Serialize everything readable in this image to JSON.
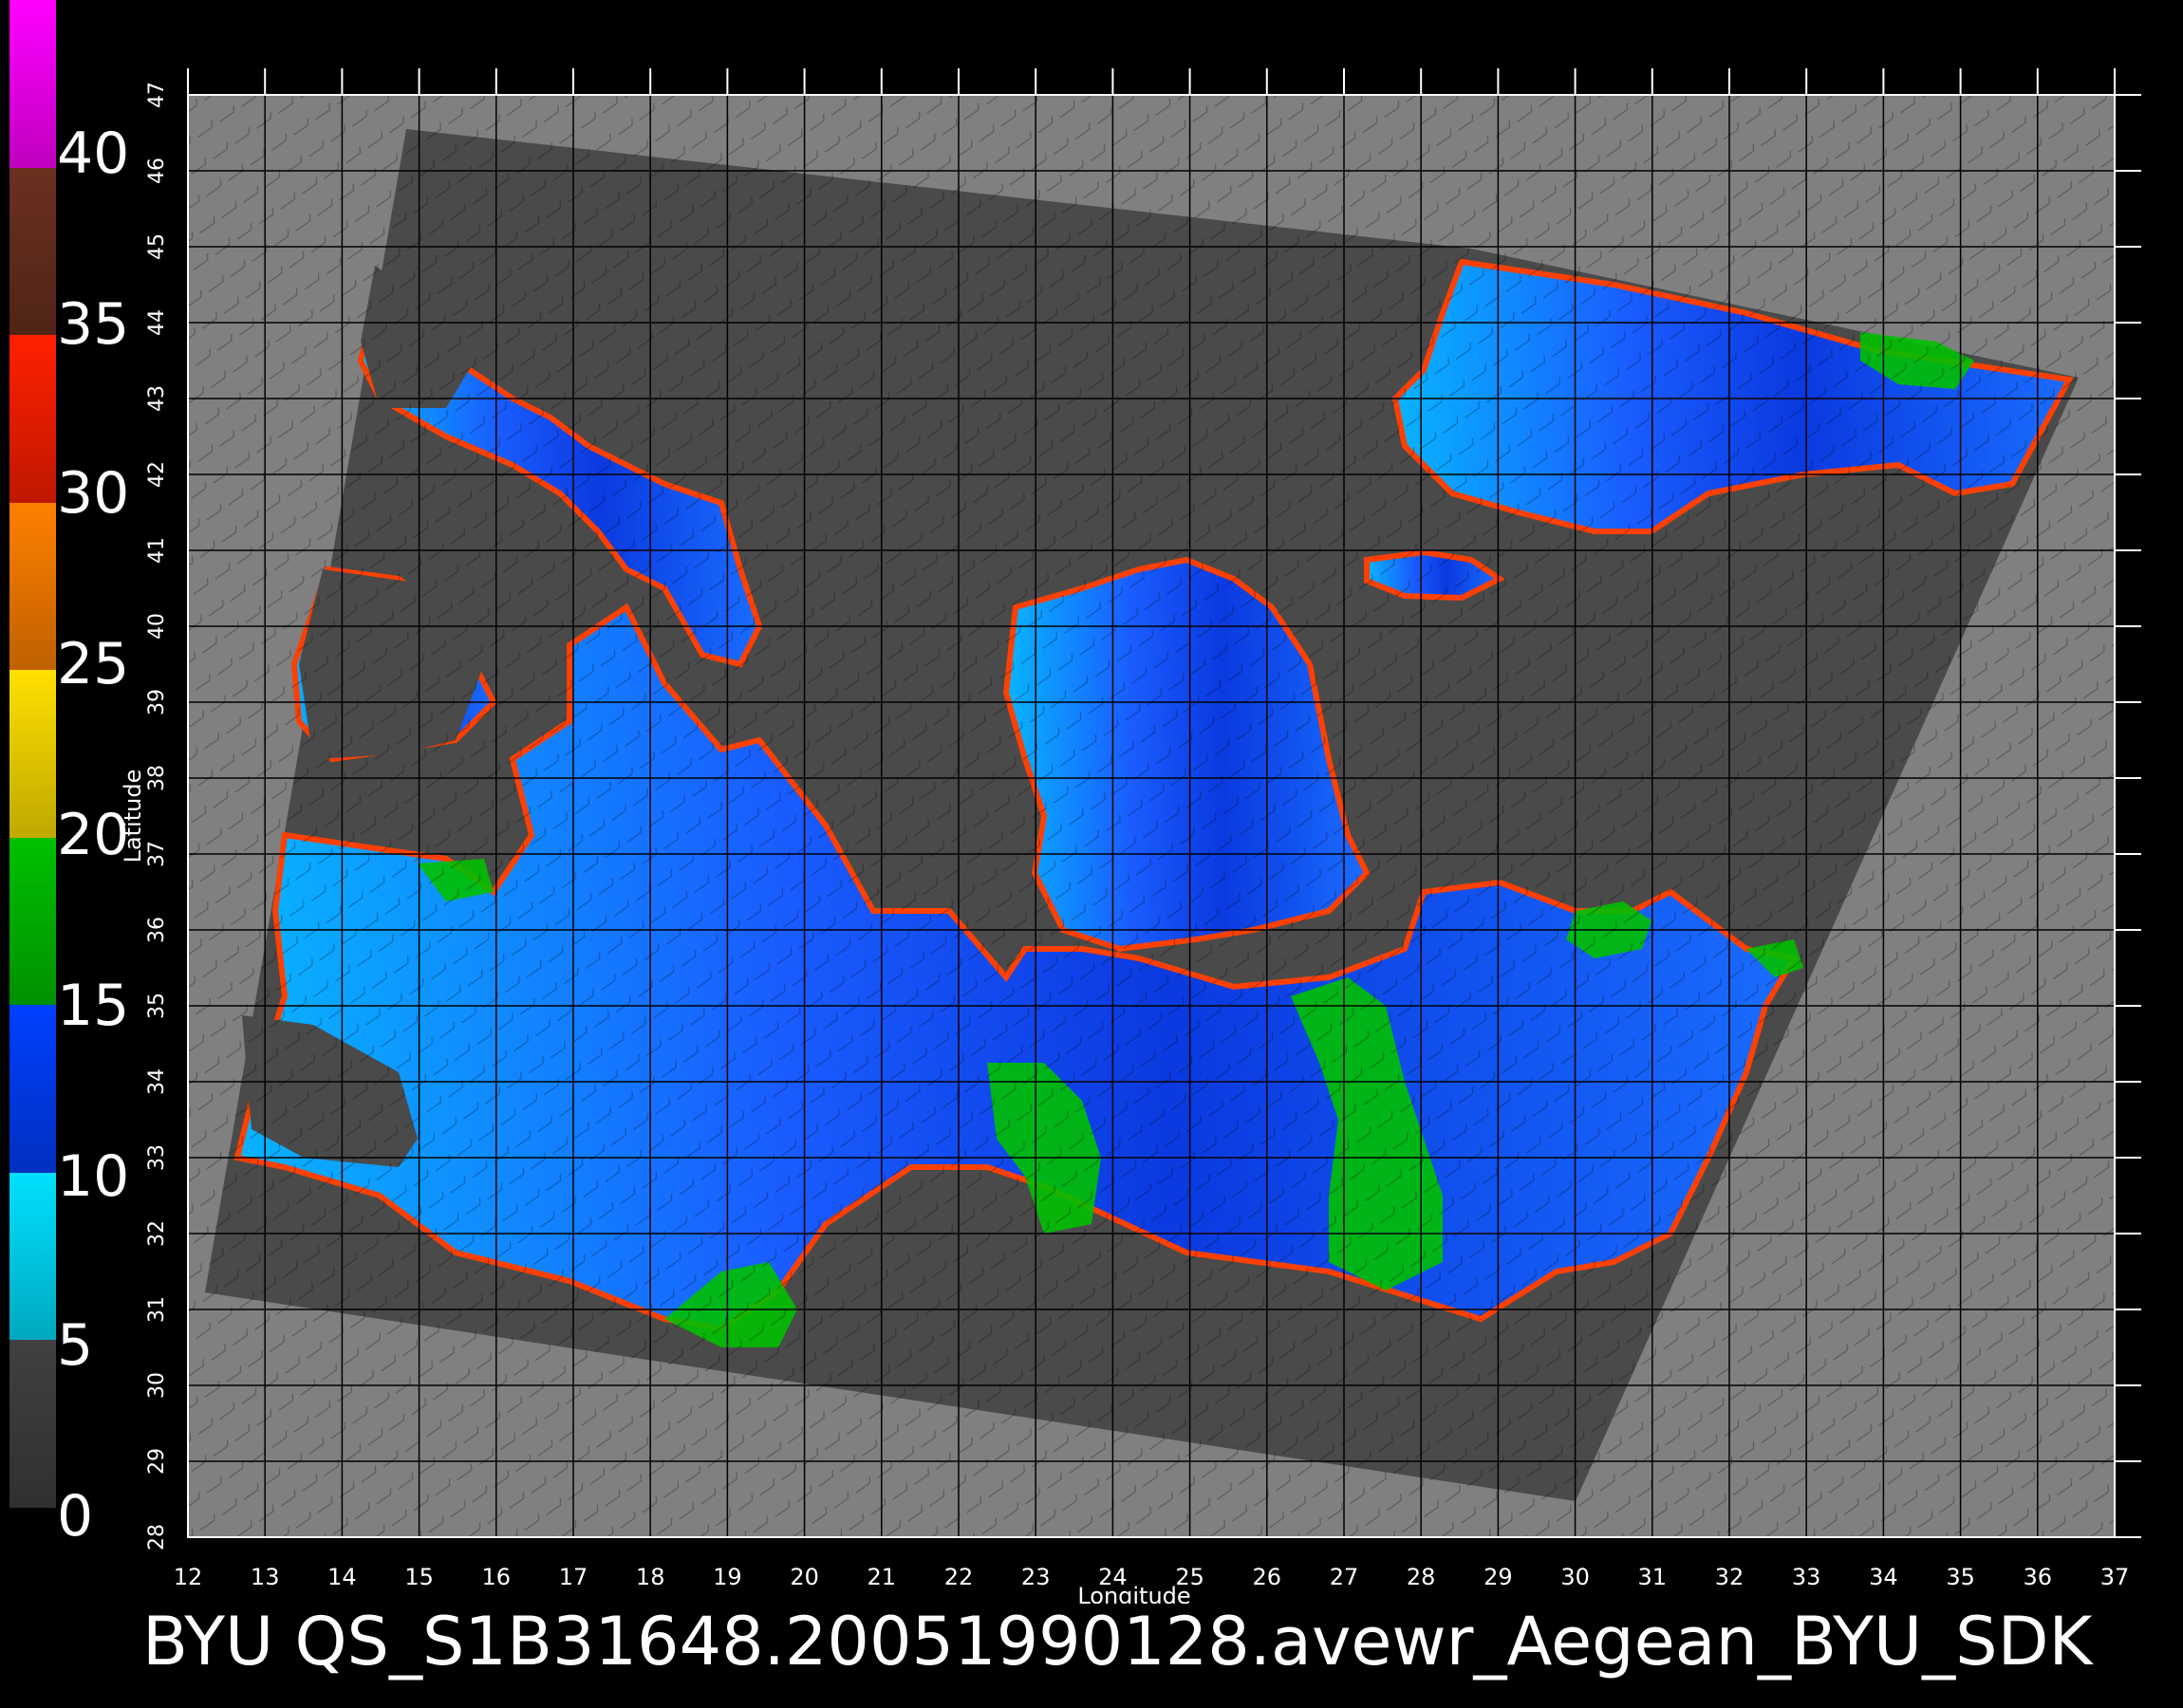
{
  "colorbar": {
    "labels": [
      "40",
      "35",
      "30",
      "25",
      "20",
      "15",
      "10",
      "5",
      "0"
    ],
    "segments": [
      {
        "from": 40,
        "to": 45,
        "color": "#ff00ff"
      },
      {
        "from": 35,
        "to": 40,
        "color": "#6b3020"
      },
      {
        "from": 30,
        "to": 35,
        "color": "#ff2000"
      },
      {
        "from": 25,
        "to": 30,
        "color": "#ff8000"
      },
      {
        "from": 20,
        "to": 25,
        "color": "#ffe000"
      },
      {
        "from": 15,
        "to": 20,
        "color": "#00c000"
      },
      {
        "from": 10,
        "to": 15,
        "color": "#0040ff"
      },
      {
        "from": 5,
        "to": 10,
        "color": "#00e0ff"
      },
      {
        "from": 0,
        "to": 5,
        "color": "#404040"
      }
    ]
  },
  "map": {
    "xlabel": "Longitude",
    "ylabel": "Latitude",
    "lon_ticks": [
      "12",
      "13",
      "14",
      "15",
      "16",
      "17",
      "18",
      "19",
      "20",
      "21",
      "22",
      "23",
      "24",
      "25",
      "26",
      "27",
      "28",
      "29",
      "30",
      "31",
      "32",
      "33",
      "34",
      "35",
      "36",
      "37"
    ],
    "lat_ticks": [
      "28",
      "29",
      "30",
      "31",
      "32",
      "33",
      "34",
      "35",
      "36",
      "37",
      "38",
      "39",
      "40",
      "41",
      "42",
      "43",
      "44",
      "45",
      "46",
      "47"
    ],
    "lon_range": [
      12,
      37
    ],
    "lat_range": [
      28,
      47
    ],
    "colors": {
      "background": "#000000",
      "outside_swath": "#808080",
      "swath": "#4a4a4a",
      "grid": "#000000",
      "ocean_low": "#00d8ff",
      "ocean_mid": "#1a5cff",
      "ocean_high": "#00c000"
    }
  },
  "title": "BYU  QS_S1B31648.20051990128.avewr_Aegean_BYU_SDK"
}
